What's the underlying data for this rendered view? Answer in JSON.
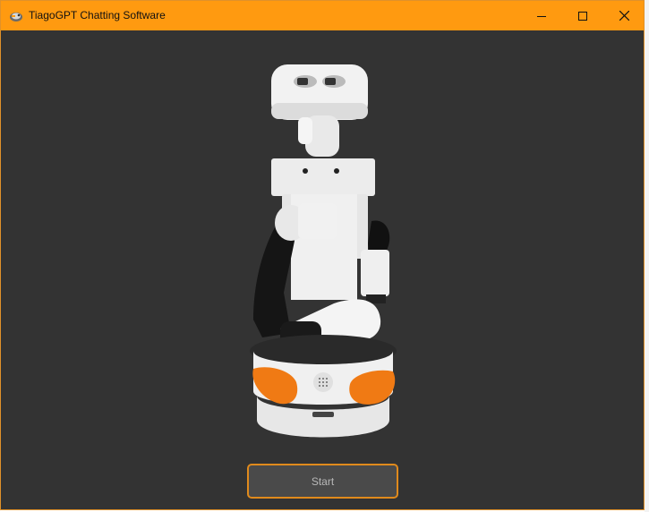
{
  "window": {
    "title": "TiagoGPT Chatting Software",
    "accent_color": "#ff9a10",
    "background_color": "#333333",
    "controls": {
      "minimize_icon": "minimize-icon",
      "maximize_icon": "maximize-icon",
      "close_icon": "close-icon"
    }
  },
  "content": {
    "image": "tiago-robot",
    "start_label": "Start"
  }
}
